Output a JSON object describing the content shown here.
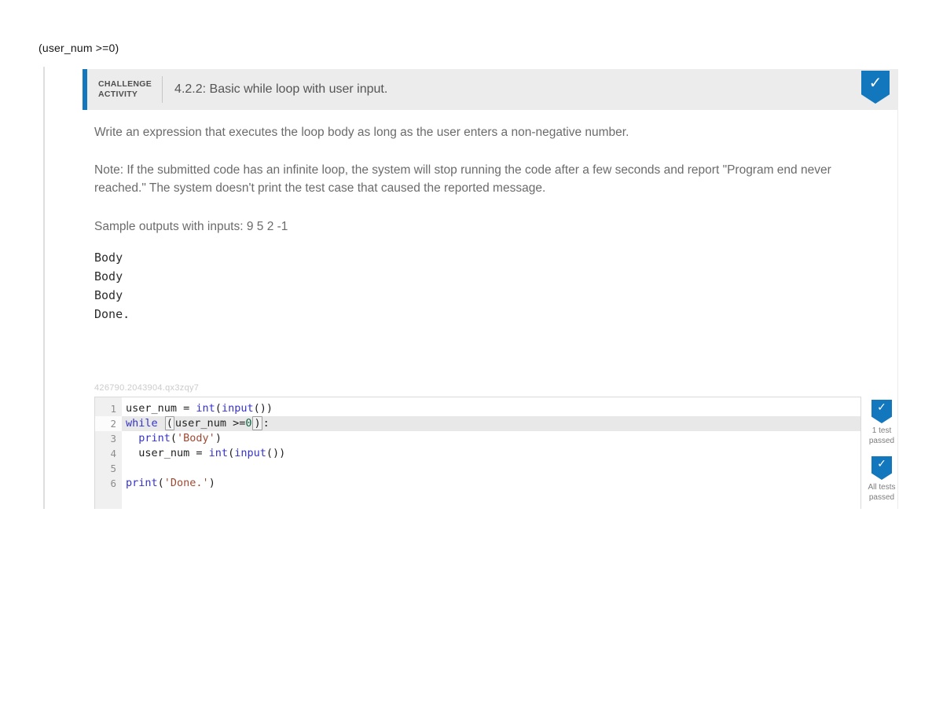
{
  "page": {
    "floating_text": "(user_num >=0)"
  },
  "colors": {
    "accent_blue": "#1377bd",
    "keyword": "#3432cd",
    "string": "#9d4a34",
    "number": "#116644"
  },
  "header": {
    "kicker_line1": "CHALLENGE",
    "kicker_line2": "ACTIVITY",
    "title": "4.2.2: Basic while loop with user input.",
    "badge_icon": "check"
  },
  "instructions": {
    "paragraph1": "Write an expression that executes the loop body as long as the user enters a non-negative number.",
    "note": "Note: If the submitted code has an infinite loop, the system will stop running the code after a few seconds and report \"Program end never reached.\" The system doesn't print the test case that caused the reported message.",
    "sample_label": "Sample outputs with inputs: 9 5 2 -1",
    "sample_output_lines": [
      "Body",
      "Body",
      "Body",
      "Done."
    ]
  },
  "editor": {
    "resource_id": "426790.2043904.qx3zqy7",
    "language": "python",
    "active_line": 2,
    "lines": [
      {
        "n": "1",
        "active": false,
        "tokens": [
          [
            "p",
            "user_num = "
          ],
          [
            "k",
            "int"
          ],
          [
            "p",
            "("
          ],
          [
            "k",
            "input"
          ],
          [
            "p",
            "())"
          ]
        ]
      },
      {
        "n": "2",
        "active": true,
        "tokens": [
          [
            "k",
            "while"
          ],
          [
            "p",
            " "
          ],
          [
            "b",
            "("
          ],
          [
            "p",
            "user_num >="
          ],
          [
            "n",
            "0"
          ],
          [
            "b",
            ")"
          ],
          [
            "p",
            ":"
          ]
        ]
      },
      {
        "n": "3",
        "active": false,
        "tokens": [
          [
            "p",
            "  "
          ],
          [
            "k",
            "print"
          ],
          [
            "p",
            "("
          ],
          [
            "s",
            "'Body'"
          ],
          [
            "p",
            ")"
          ]
        ]
      },
      {
        "n": "4",
        "active": false,
        "tokens": [
          [
            "p",
            "  user_num = "
          ],
          [
            "k",
            "int"
          ],
          [
            "p",
            "("
          ],
          [
            "k",
            "input"
          ],
          [
            "p",
            "())"
          ]
        ]
      },
      {
        "n": "5",
        "active": false,
        "tokens": []
      },
      {
        "n": "6",
        "active": false,
        "tokens": [
          [
            "k",
            "print"
          ],
          [
            "p",
            "("
          ],
          [
            "s",
            "'Done.'"
          ],
          [
            "p",
            ")"
          ]
        ]
      }
    ]
  },
  "tests": {
    "items": [
      {
        "icon": "check",
        "line1": "1 test",
        "line2": "passed"
      },
      {
        "icon": "check",
        "line1": "All tests",
        "line2": "passed"
      }
    ]
  }
}
